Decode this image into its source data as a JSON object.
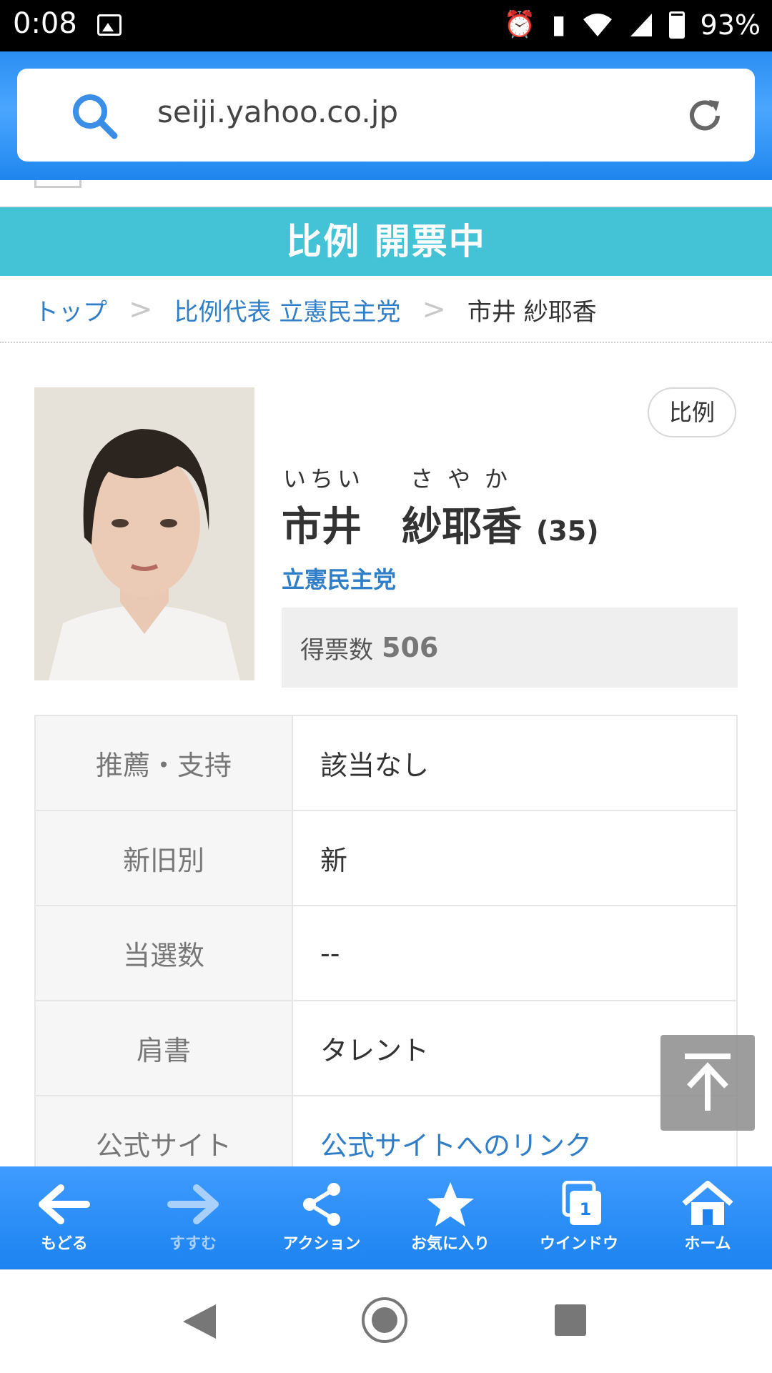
{
  "status_bar": {
    "time": "0:08",
    "battery": "93%"
  },
  "browser": {
    "url": "seiji.yahoo.co.jp"
  },
  "banner": {
    "title": "比例 開票中"
  },
  "breadcrumb": {
    "items": [
      {
        "label": "トップ"
      },
      {
        "label": "比例代表 立憲民主党"
      },
      {
        "label": "市井 紗耶香"
      }
    ]
  },
  "candidate": {
    "tag": "比例",
    "ruby_family": "いちい",
    "ruby_given": "さやか",
    "name": "市井　紗耶香",
    "age": "(35)",
    "party": "立憲民主党",
    "votes_label": "得票数",
    "votes": "506"
  },
  "info": [
    {
      "label": "推薦・支持",
      "value": "該当なし"
    },
    {
      "label": "新旧別",
      "value": "新"
    },
    {
      "label": "当選数",
      "value": "--"
    },
    {
      "label": "肩書",
      "value": "タレント"
    },
    {
      "label": "公式サイト",
      "value": "公式サイトへのリンク"
    }
  ],
  "toolbar": {
    "back": "もどる",
    "forward": "すすむ",
    "action": "アクション",
    "favorites": "お気に入り",
    "window": "ウインドウ",
    "window_count": "1",
    "home": "ホーム"
  },
  "colors": {
    "banner": "#44c2d6",
    "link": "#2f7ec7",
    "toolbar": "#1c83f0"
  }
}
